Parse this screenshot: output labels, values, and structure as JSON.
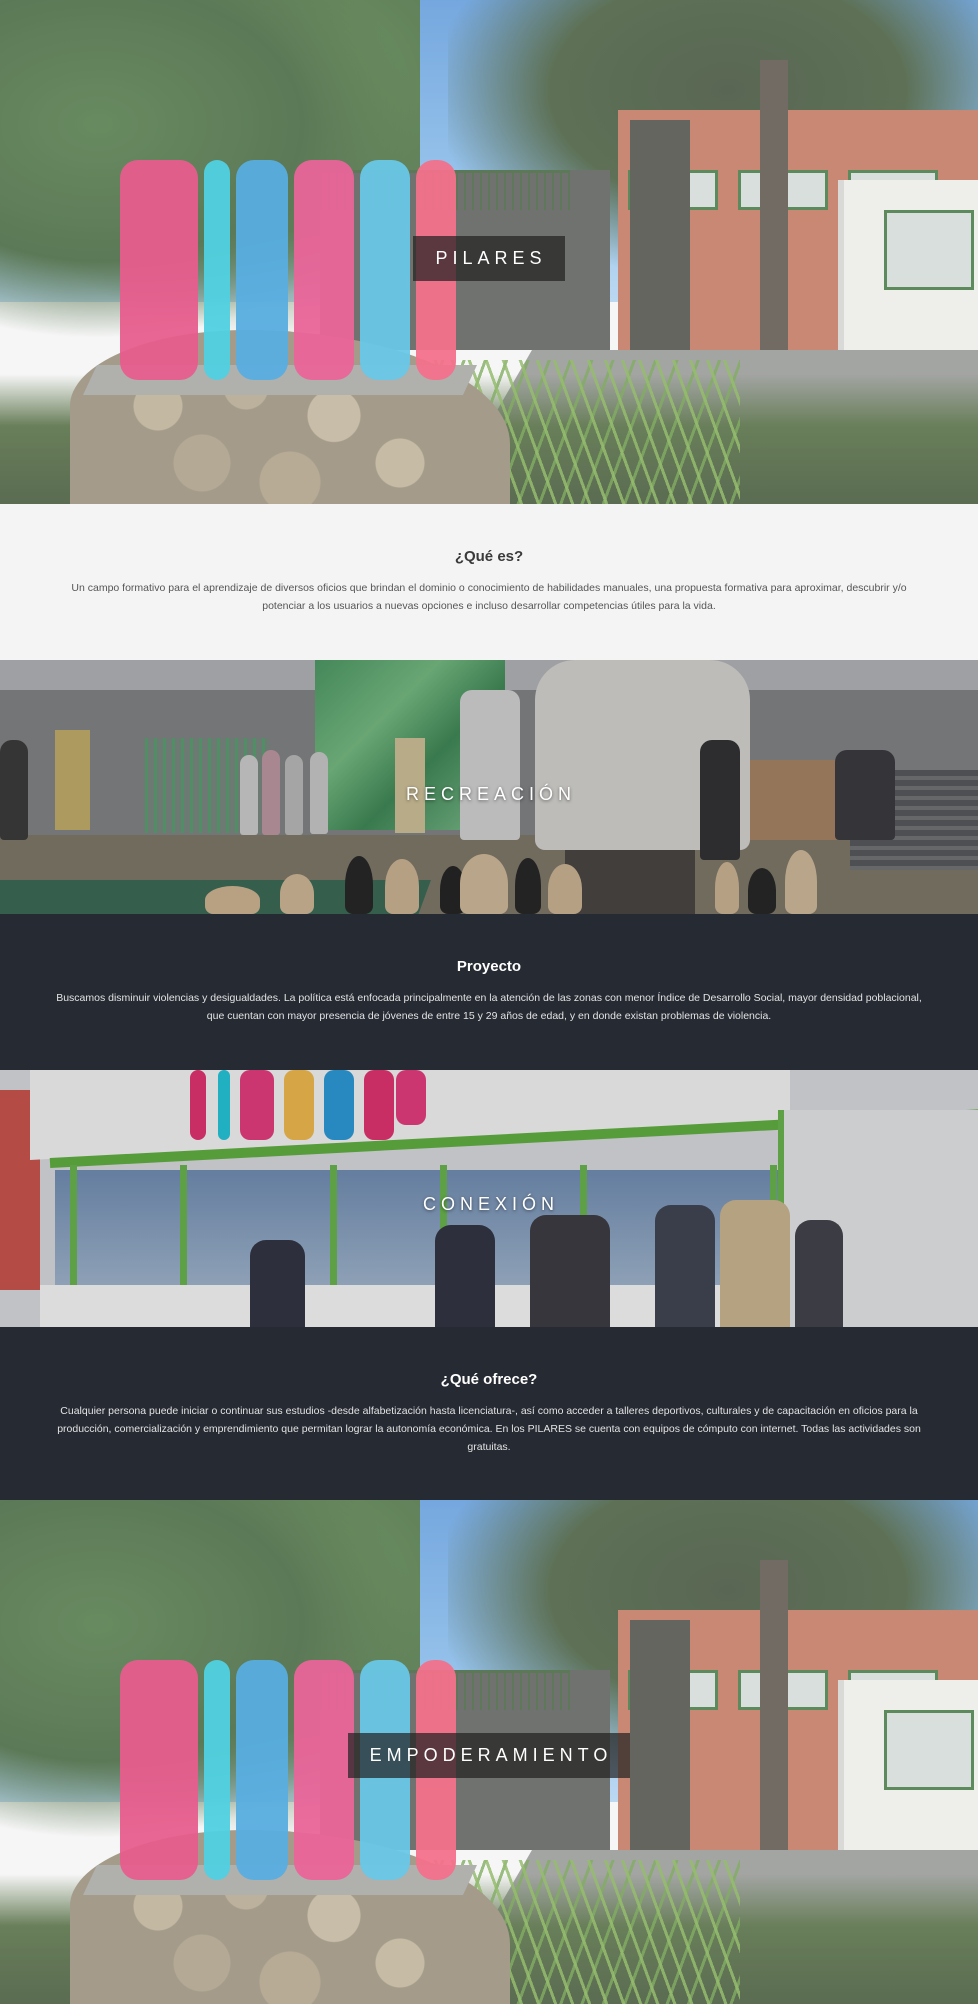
{
  "hero_1": {
    "caption": "PILARES"
  },
  "que_es": {
    "title": "¿Qué es?",
    "text": "Un campo formativo para el aprendizaje de diversos oficios que brindan el dominio o conocimiento de habilidades manuales, una propuesta formativa para aproximar, descubrir y/o potenciar a los usuarios a nuevas opciones e incluso desarrollar competencias útiles para la vida."
  },
  "hero_2": {
    "caption": "RECREACIÓN"
  },
  "proyecto": {
    "title": "Proyecto",
    "text": "Buscamos disminuir violencias y desigualdades. La política está enfocada principalmente en la atención de las zonas con menor Índice de Desarrollo Social, mayor densidad poblacional, que cuentan con mayor presencia de jóvenes de entre 15 y 29 años de edad, y en donde existan problemas de violencia."
  },
  "hero_3": {
    "caption": "CONEXIÓN"
  },
  "ofrece": {
    "title": "¿Qué ofrece?",
    "text": "Cualquier persona puede iniciar o continuar sus estudios -desde alfabetización hasta licenciatura-, así como acceder a talleres deportivos, culturales y de capacitación en oficios para la producción, comercialización y emprendimiento que permitan lograr la autonomía económica. En los PILARES se cuenta con equipos de cómputo con internet. Todas las actividades son gratuitas."
  },
  "hero_4": {
    "caption": "EMPODERAMIENTO"
  },
  "colors": {
    "light_bg": "#f4f4f4",
    "dark_bg": "#262a33",
    "caption_box": "#232323"
  }
}
